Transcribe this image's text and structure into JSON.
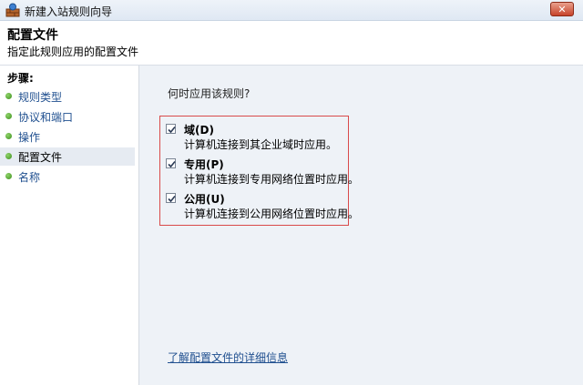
{
  "window": {
    "title": "新建入站规则向导",
    "close_label": "✕"
  },
  "header": {
    "title": "配置文件",
    "subtitle": "指定此规则应用的配置文件"
  },
  "sidebar": {
    "heading": "步骤:",
    "items": [
      {
        "label": "规则类型"
      },
      {
        "label": "协议和端口"
      },
      {
        "label": "操作"
      },
      {
        "label": "配置文件"
      },
      {
        "label": "名称"
      }
    ],
    "current_index": 3
  },
  "main": {
    "question": "何时应用该规则?",
    "options": [
      {
        "title": "域(D)",
        "description": "计算机连接到其企业域时应用。",
        "checked": true
      },
      {
        "title": "专用(P)",
        "description": "计算机连接到专用网络位置时应用。",
        "checked": true
      },
      {
        "title": "公用(U)",
        "description": "计算机连接到公用网络位置时应用。",
        "checked": true
      }
    ],
    "more_link": "了解配置文件的详细信息"
  }
}
